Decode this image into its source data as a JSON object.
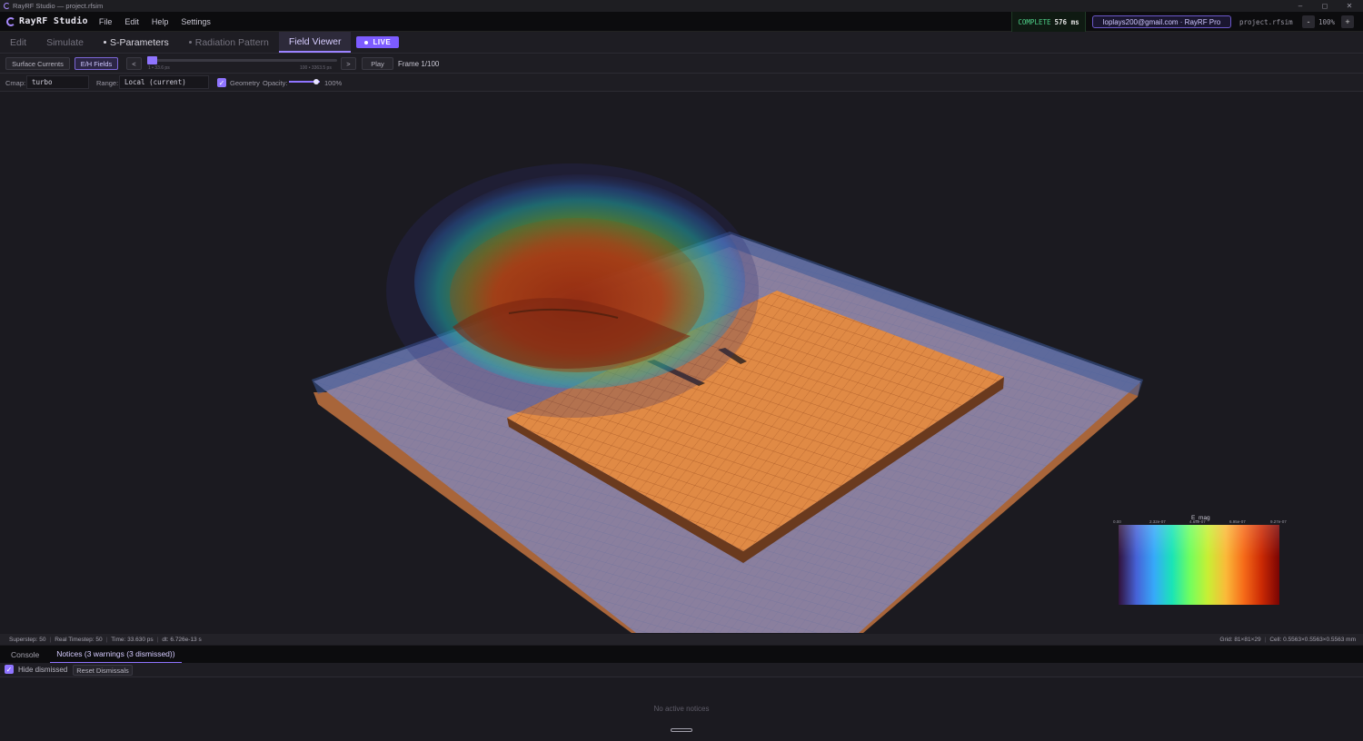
{
  "window": {
    "title": "RayRF Studio — project.rfsim",
    "minimize": "–",
    "maximize": "◻",
    "close": "✕"
  },
  "menubar": {
    "brand": "RayRF Studio",
    "menus": [
      "File",
      "Edit",
      "Help",
      "Settings"
    ],
    "status_label": "COMPLETE",
    "status_time": "576 ms",
    "account": "loplays200@gmail.com · RayRF Pro",
    "project_file": "project.rfsim",
    "zoom_minus": "-",
    "zoom": "100%",
    "zoom_plus": "+"
  },
  "tabs": [
    {
      "label": "Edit",
      "state": "dim"
    },
    {
      "label": "Simulate",
      "state": "dim"
    },
    {
      "label": "S-Parameters",
      "state": "dot-bright"
    },
    {
      "label": "Radiation Pattern",
      "state": "dot-dim"
    },
    {
      "label": "Field Viewer",
      "state": "active"
    }
  ],
  "live_badge": "LIVE",
  "toolbar": {
    "surface_currents": "Surface Currents",
    "eh_fields": "E/H Fields",
    "prev": "<",
    "slider_min": "1 • 33.6 ps",
    "slider_max": "100 • 3363.5 ps",
    "frame_position": 0.0,
    "next": ">",
    "play": "Play",
    "frame": "Frame 1/100"
  },
  "view_options": {
    "cmap_label": "Cmap:",
    "cmap_value": "turbo",
    "range_label": "Range:",
    "range_value": "Local (current)",
    "geometry_checked": true,
    "geometry_label": "Geometry",
    "opacity_label": "Opacity:",
    "opacity_value": "100%",
    "opacity_fraction": 1.0
  },
  "colorbar": {
    "title": "E_mag",
    "ticks": [
      "0.00",
      "2.32e-07",
      "4.64e-07",
      "6.95e-07",
      "9.27e-07"
    ],
    "colormap": "turbo"
  },
  "statusbar": {
    "superstep": "Superstep: 50",
    "real_timestep": "Real Timestep: 50",
    "time": "Time: 33.630 ps",
    "dt": "dt: 6.726e-13 s",
    "grid": "Grid: 81×81×29",
    "cell": "Cell: 0.5563×0.5563×0.5563 mm"
  },
  "bottom_panel": {
    "tabs": [
      "Console",
      "Notices (3 warnings (3 dismissed))"
    ],
    "active_tab": 1,
    "hide_dismissed_checked": true,
    "hide_dismissed": "Hide dismissed",
    "reset_dismissals": "Reset Dismissals",
    "empty": "No active notices"
  },
  "colors": {
    "accent": "#8f74ff",
    "complete": "#4fd38a",
    "patch": "#e08a45",
    "substrate": "#8a7f9e",
    "ground_edge": "#a86a3a",
    "background": "#1b1a20"
  }
}
